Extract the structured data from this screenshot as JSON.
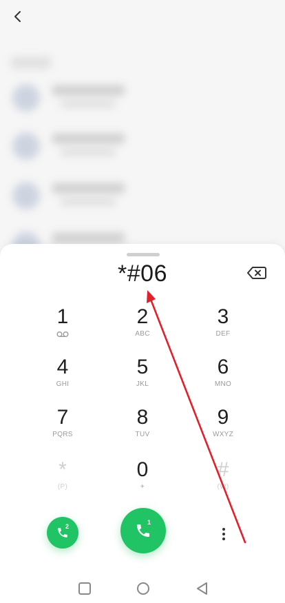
{
  "dialer": {
    "number": "*#06",
    "keys": [
      {
        "digit": "1",
        "sub": "",
        "voicemail": true
      },
      {
        "digit": "2",
        "sub": "ABC"
      },
      {
        "digit": "3",
        "sub": "DEF"
      },
      {
        "digit": "4",
        "sub": "GHI"
      },
      {
        "digit": "5",
        "sub": "JKL"
      },
      {
        "digit": "6",
        "sub": "MNO"
      },
      {
        "digit": "7",
        "sub": "PQRS"
      },
      {
        "digit": "8",
        "sub": "TUV"
      },
      {
        "digit": "9",
        "sub": "WXYZ"
      },
      {
        "digit": "*",
        "sub": "(P)"
      },
      {
        "digit": "0",
        "sub": "+"
      },
      {
        "digit": "#",
        "sub": "(W)"
      }
    ],
    "sim1_label": "1",
    "sim2_label": "2"
  },
  "colors": {
    "call_green": "#21c465",
    "arrow_red": "#e0202a"
  },
  "icons": [
    "back-arrow-icon",
    "backspace-icon",
    "voicemail-icon",
    "phone-icon",
    "more-vertical-icon",
    "nav-square-icon",
    "nav-circle-icon",
    "nav-triangle-icon"
  ]
}
